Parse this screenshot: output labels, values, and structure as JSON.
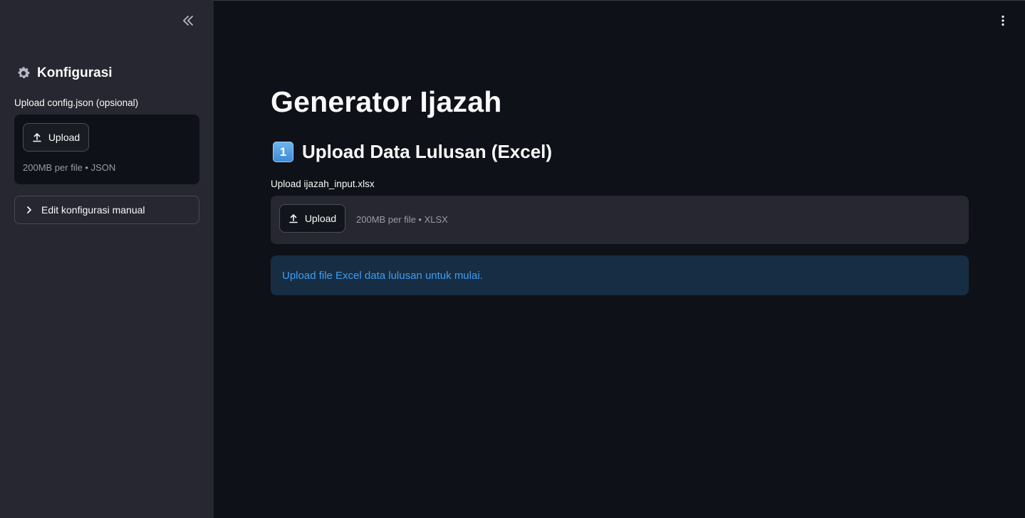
{
  "sidebar": {
    "title": "Konfigurasi",
    "uploader": {
      "label": "Upload config.json (opsional)",
      "button_label": "Upload",
      "hint": "200MB per file • JSON"
    },
    "expander_label": "Edit konfigurasi manual"
  },
  "main": {
    "title": "Generator Ijazah",
    "section": {
      "number": "1",
      "title": "Upload Data Lulusan (Excel)"
    },
    "uploader": {
      "label": "Upload ijazah_input.xlsx",
      "button_label": "Upload",
      "hint": "200MB per file • XLSX"
    },
    "info_message": "Upload file Excel data lulusan untuk mulai."
  },
  "colors": {
    "app_background": "#0e1117",
    "sidebar_background": "#262730",
    "info_text": "#3d9df3",
    "info_background": "#172d43"
  },
  "icons": {
    "collapse": "double-chevron-left-icon",
    "menu": "vertical-dots-icon",
    "settings": "gear-icon",
    "upload": "upload-icon",
    "expander": "chevron-right-icon"
  }
}
